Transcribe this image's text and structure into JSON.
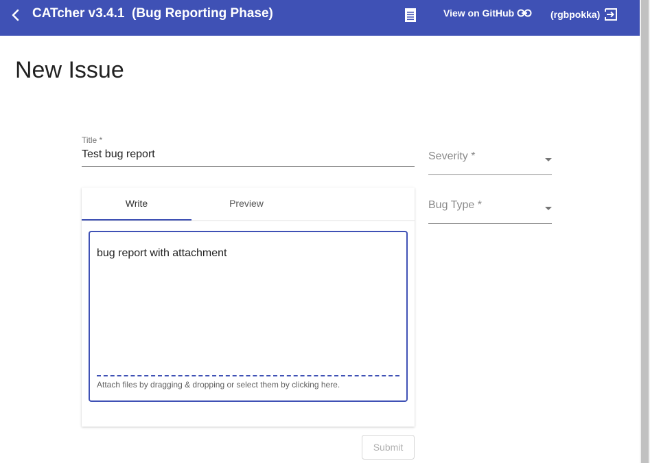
{
  "toolbar": {
    "title": "CATcher v3.4.1  (Bug Reporting Phase)",
    "github_label": "View on GitHub",
    "user_label": "(rgbpokka)"
  },
  "page": {
    "title": "New Issue"
  },
  "form": {
    "title_label": "Title *",
    "title_value": "Test bug report",
    "severity_placeholder": "Severity *",
    "bug_type_placeholder": "Bug Type *",
    "tabs": [
      {
        "label": "Write",
        "active": true
      },
      {
        "label": "Preview",
        "active": false
      }
    ],
    "description_value": "bug report with attachment",
    "attach_hint": "Attach files by dragging & dropping or select them by clicking here.",
    "submit_label": "Submit"
  },
  "colors": {
    "primary": "#3f51b5"
  },
  "icons": [
    "chevron-left-icon",
    "log-icon",
    "link-icon",
    "logout-icon",
    "arrow-drop-down-icon"
  ]
}
